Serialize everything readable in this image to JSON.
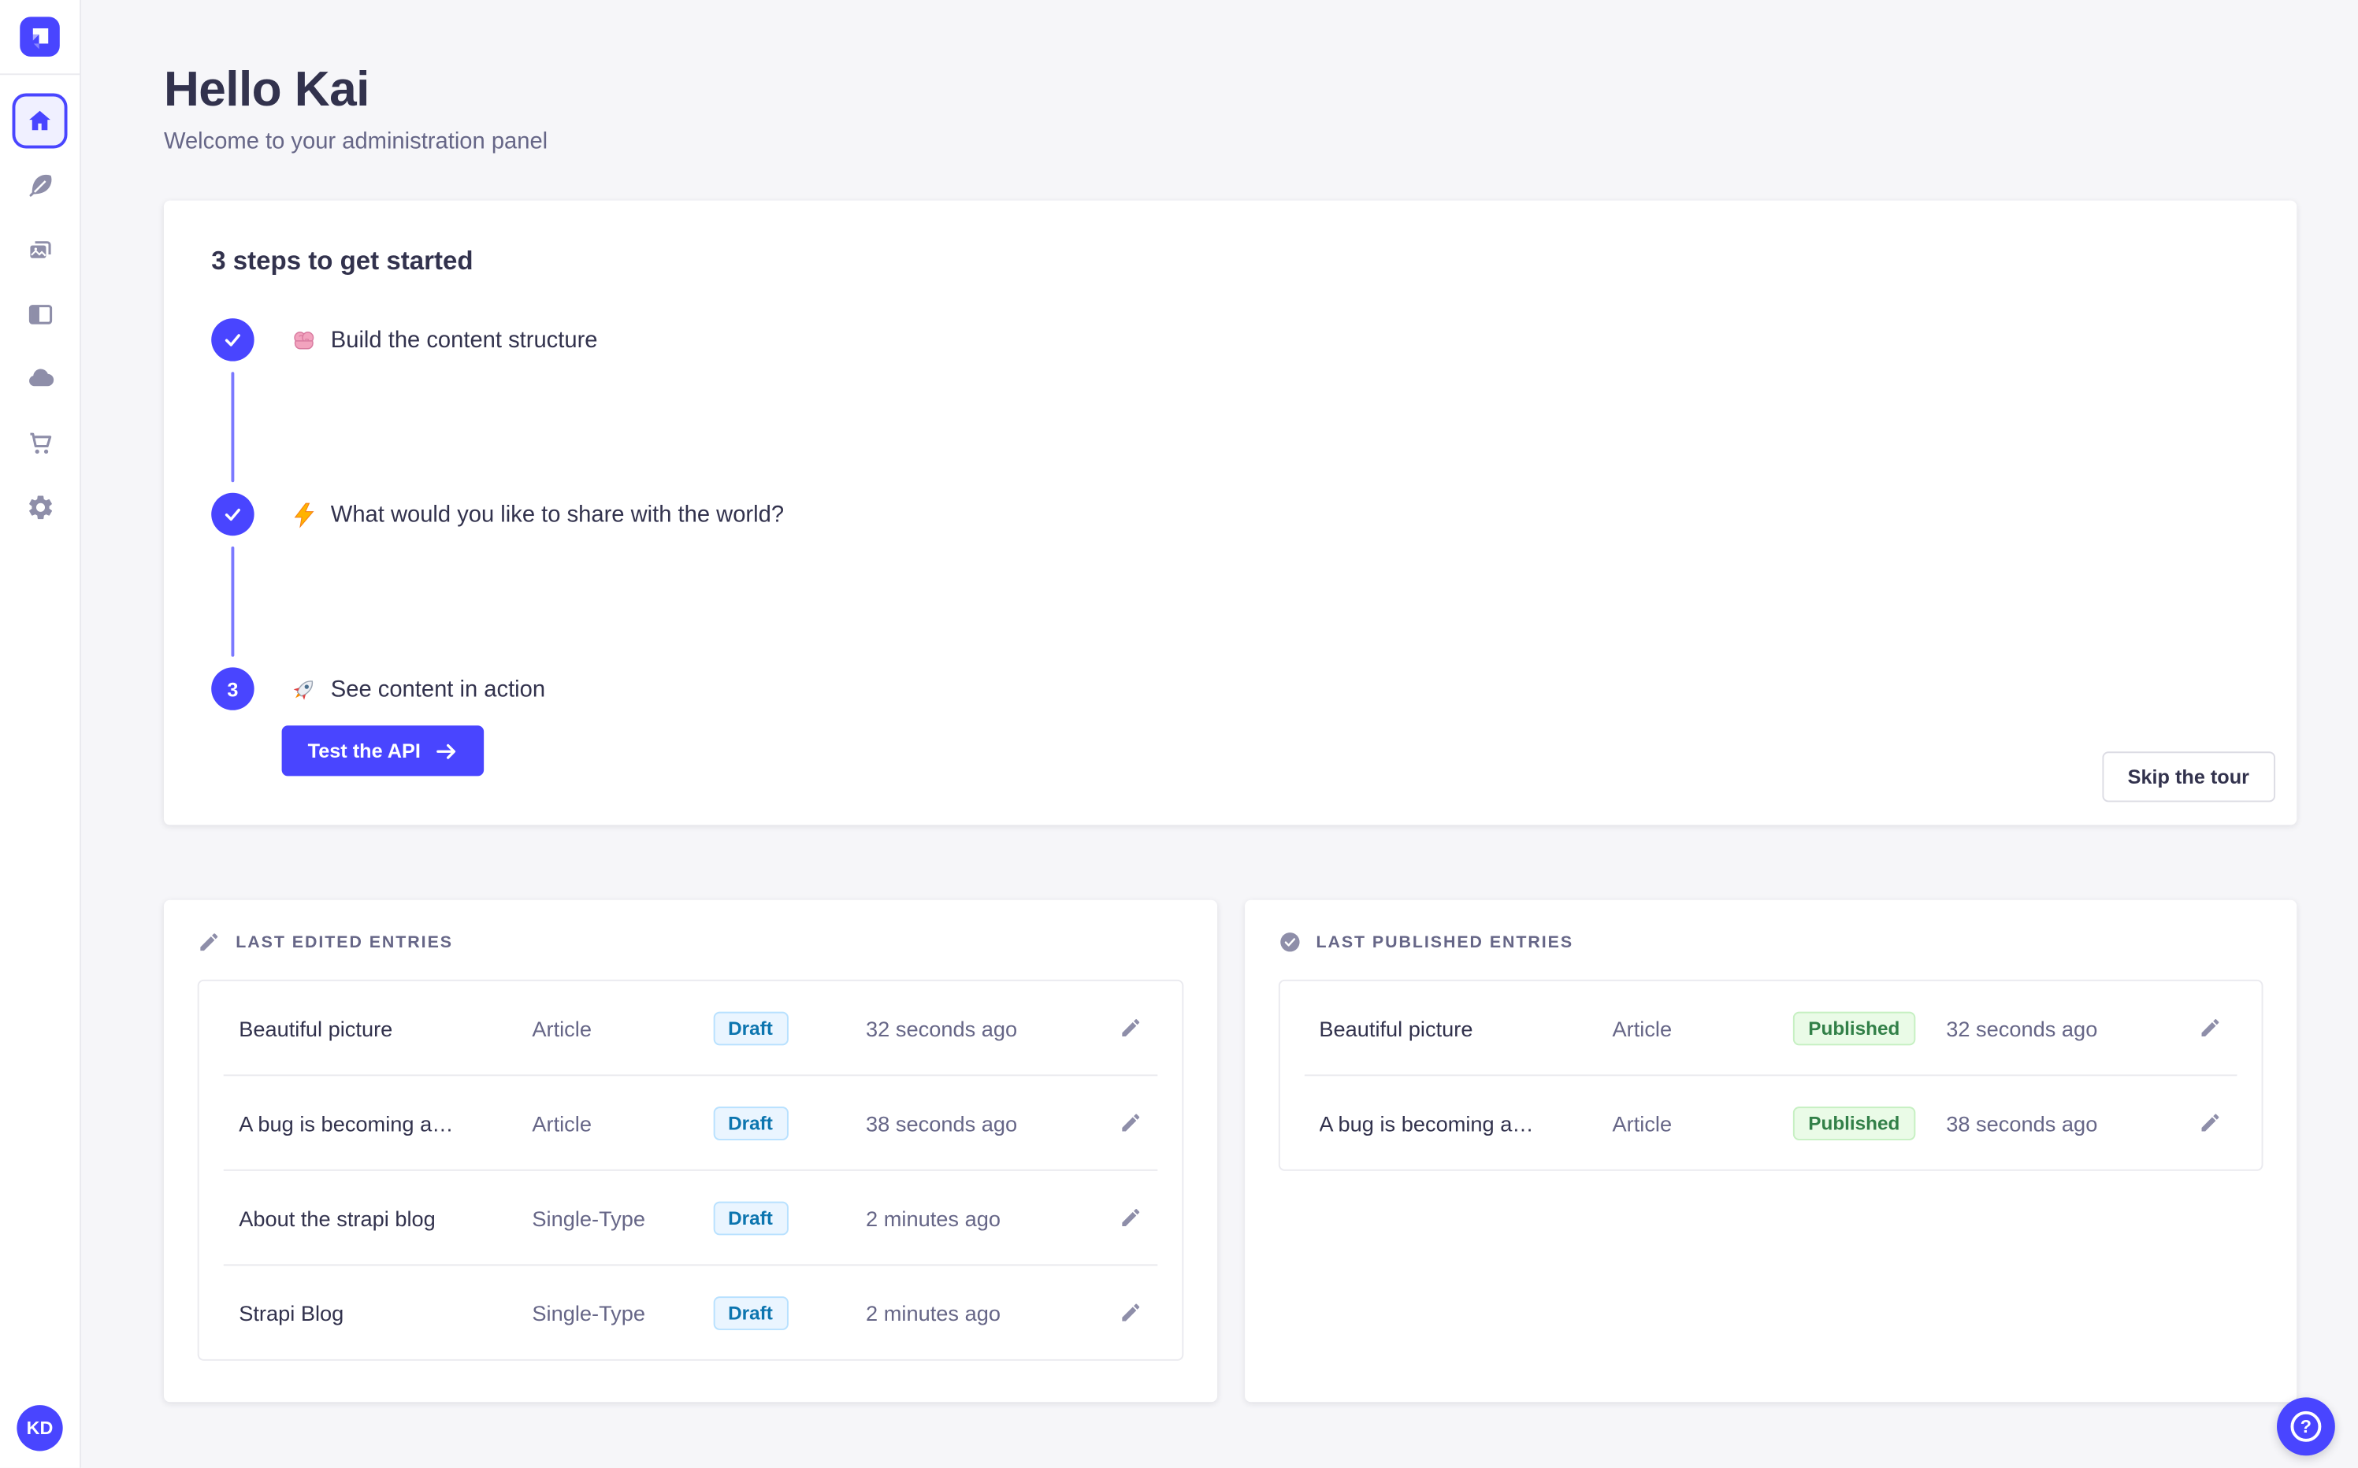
{
  "header": {
    "title": "Hello Kai",
    "subtitle": "Welcome to your administration panel"
  },
  "sidebar": {
    "logo_icon": "strapi-logo-icon",
    "nav_icons": [
      "home-icon",
      "feather-icon",
      "pictures-icon",
      "layout-icon",
      "cloud-icon",
      "cart-icon",
      "gear-icon"
    ],
    "active_item": "home",
    "avatar_initials": "KD"
  },
  "onboarding": {
    "title": "3 steps to get started",
    "steps": [
      {
        "icon": "brain-emoji",
        "label": "Build the content structure",
        "state": "completed"
      },
      {
        "icon": "zap-emoji",
        "label": "What would you like to share with the world?",
        "state": "completed"
      },
      {
        "icon": "rocket-emoji",
        "label": "See content in action",
        "state": "active",
        "number": "3"
      }
    ],
    "cta_label": "Test the API",
    "cta_icon": "arrow-right-icon",
    "skip_label": "Skip the tour"
  },
  "panels": {
    "last_edited": {
      "icon": "pencil-icon",
      "title": "LAST EDITED ENTRIES",
      "rows": [
        {
          "title": "Beautiful picture",
          "type": "Article",
          "status": "Draft",
          "time": "32 seconds ago"
        },
        {
          "title": "A bug is becoming a…",
          "type": "Article",
          "status": "Draft",
          "time": "38 seconds ago"
        },
        {
          "title": "About the strapi blog",
          "type": "Single-Type",
          "status": "Draft",
          "time": "2 minutes ago"
        },
        {
          "title": "Strapi Blog",
          "type": "Single-Type",
          "status": "Draft",
          "time": "2 minutes ago"
        }
      ]
    },
    "last_published": {
      "icon": "check-circle-icon",
      "title": "LAST PUBLISHED ENTRIES",
      "rows": [
        {
          "title": "Beautiful picture",
          "type": "Article",
          "status": "Published",
          "time": "32 seconds ago"
        },
        {
          "title": "A bug is becoming a…",
          "type": "Article",
          "status": "Published",
          "time": "38 seconds ago"
        }
      ]
    }
  },
  "floating": {
    "help_icon": "question-mark-icon",
    "help_glyph": "?"
  },
  "colors": {
    "accent": "#4945FF",
    "accent_light": "#7B79FF",
    "page_background": "#F6F6F9",
    "text_dark": "#32324D",
    "text_gray": "#666687",
    "icon_gray": "#8E8EA9",
    "border": "#EAEAEF",
    "draft_text": "#0C75AF",
    "draft_background": "#EAF5FF",
    "draft_border": "#B8E1FF",
    "published_text": "#328048",
    "published_background": "#EAFBE7",
    "published_border": "#C6F0C2"
  }
}
